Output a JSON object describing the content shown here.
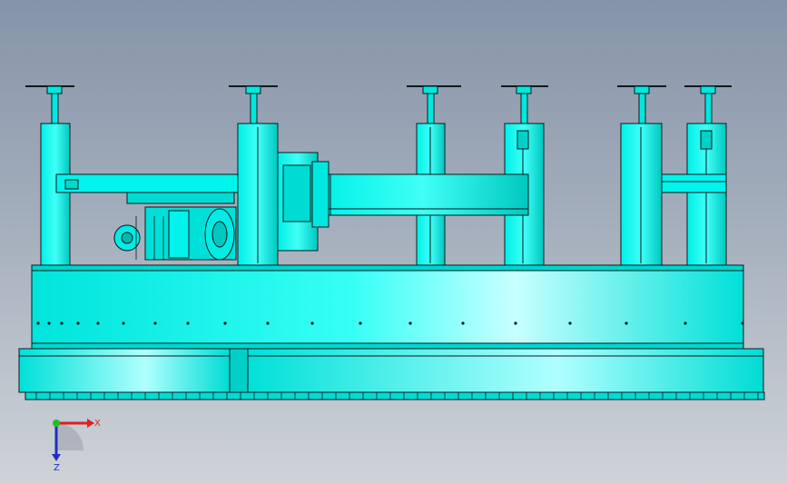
{
  "colors": {
    "body": "#00e8e0",
    "body_light": "#b8ffff",
    "body_dark": "#00b8b0",
    "outline": "#0a1a1a",
    "background_top": "#8694a8",
    "background_bottom": "#cfd3d8"
  },
  "triad": {
    "x_label": "X",
    "z_label": "Z",
    "icon": "coordinate-triad-icon"
  }
}
